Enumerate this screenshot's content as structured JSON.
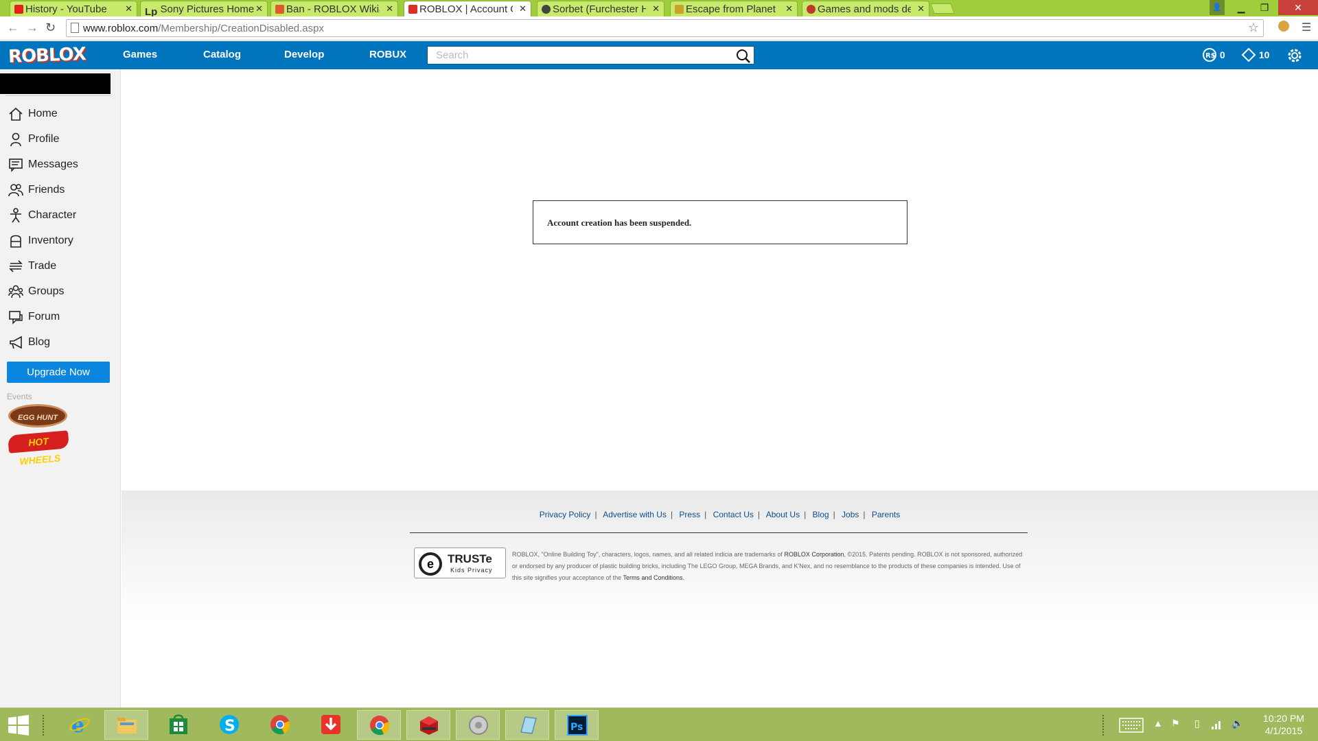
{
  "browser": {
    "tabs": [
      {
        "label": "History - YouTube",
        "favicon_color": "#e62117"
      },
      {
        "label": "Sony Pictures Home",
        "prefix": "Lp",
        "favicon_color": "#000000"
      },
      {
        "label": "Ban - ROBLOX Wikia",
        "favicon_color": "#e05a2b"
      },
      {
        "label": "ROBLOX | Account C",
        "favicon_color": "#d93025"
      },
      {
        "label": "Sorbet (Furchester H",
        "favicon_color": "#444444"
      },
      {
        "label": "Escape from Planet E",
        "favicon_color": "#c9a227"
      },
      {
        "label": "Games and mods de",
        "favicon_color": "#c0392b"
      }
    ],
    "address": {
      "host": "www.roblox.com",
      "path": "/Membership/CreationDisabled.aspx"
    }
  },
  "header": {
    "logo": "ROBLOX",
    "nav": [
      "Games",
      "Catalog",
      "Develop",
      "ROBUX"
    ],
    "search_placeholder": "Search",
    "robux_count": "0",
    "tickets_count": "10",
    "color": "#0074bd"
  },
  "sidebar": {
    "items": [
      {
        "label": "Home",
        "icon": "home-icon"
      },
      {
        "label": "Profile",
        "icon": "profile-icon"
      },
      {
        "label": "Messages",
        "icon": "messages-icon"
      },
      {
        "label": "Friends",
        "icon": "friends-icon"
      },
      {
        "label": "Character",
        "icon": "character-icon"
      },
      {
        "label": "Inventory",
        "icon": "inventory-icon"
      },
      {
        "label": "Trade",
        "icon": "trade-icon"
      },
      {
        "label": "Groups",
        "icon": "groups-icon"
      },
      {
        "label": "Forum",
        "icon": "forum-icon"
      },
      {
        "label": "Blog",
        "icon": "blog-icon"
      }
    ],
    "upgrade_label": "Upgrade Now",
    "events_label": "Events",
    "events": [
      "EGG HUNT",
      "HOT WHEELS"
    ]
  },
  "main": {
    "message": "Account creation has been suspended."
  },
  "footer": {
    "links": [
      "Privacy Policy",
      "Advertise with Us",
      "Press",
      "Contact Us",
      "About Us",
      "Blog",
      "Jobs",
      "Parents"
    ],
    "truste_title": "TRUSTe",
    "truste_sub": "Kids Privacy",
    "legal_1": "ROBLOX, \"Online Building Toy\", characters, logos, names, and all related indicia are trademarks of ",
    "legal_corp": "ROBLOX Corporation",
    "legal_2": ", ©2015. Patents pending. ROBLOX is not sponsored, authorized or endorsed by any producer of plastic building bricks, including The LEGO Group, MEGA Brands, and K'Nex, and no resemblance to the products of these companies is intended. Use of this site signifies your acceptance of the ",
    "legal_terms": "Terms and Conditions",
    "legal_3": "."
  },
  "taskbar": {
    "time": "10:20 PM",
    "date": "4/1/2015"
  }
}
